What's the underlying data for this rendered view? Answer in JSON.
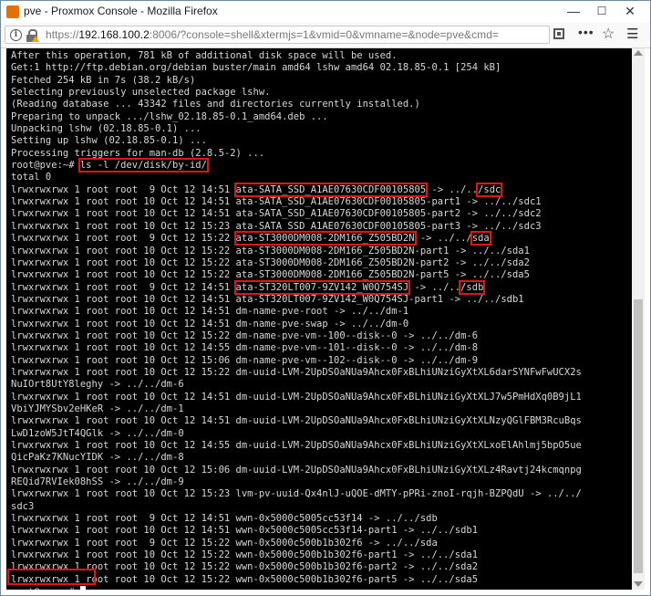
{
  "window": {
    "title": "pve - Proxmox Console - Mozilla Firefox",
    "icon": "proxmox-icon",
    "controls": [
      "—",
      "☐",
      "✕"
    ]
  },
  "address_bar": {
    "protocol": "https://",
    "host": "192.168.100.2",
    "rest": ":8006/?console=shell&xtermjs=1&vmid=0&vmname=&node=pve&cmd="
  },
  "colors": {
    "terminal_bg": "#000000",
    "terminal_fg": "#d7d7d7",
    "highlight": "#e01616"
  },
  "terminal": {
    "lines": [
      "After this operation, 781 kB of additional disk space will be used.",
      "Get:1 http://ftp.debian.org/debian buster/main amd64 lshw amd64 02.18.85-0.1 [254 kB]",
      "Fetched 254 kB in 7s (38.2 kB/s)",
      "Selecting previously unselected package lshw.",
      "(Reading database ... 43342 files and directories currently installed.)",
      "Preparing to unpack .../lshw_02.18.85-0.1_amd64.deb ...",
      "Unpacking lshw (02.18.85-0.1) ...",
      "Setting up lshw (02.18.85-0.1) ...",
      "Processing triggers for man-db (2.8.5-2) ...",
      "root@pve:~# ls -l /dev/disk/by-id/",
      "total 0",
      "lrwxrwxrwx 1 root root  9 Oct 12 14:51 ata-SATA_SSD_A1AE07630CDF00105805 -> ../../sdc",
      "lrwxrwxrwx 1 root root 10 Oct 12 14:51 ata-SATA_SSD_A1AE07630CDF00105805-part1 -> ../../sdc1",
      "lrwxrwxrwx 1 root root 10 Oct 12 14:51 ata-SATA_SSD_A1AE07630CDF00105805-part2 -> ../../sdc2",
      "lrwxrwxrwx 1 root root 10 Oct 12 15:23 ata-SATA_SSD_A1AE07630CDF00105805-part3 -> ../../sdc3",
      "lrwxrwxrwx 1 root root  9 Oct 12 15:22 ata-ST3000DM008-2DM166_Z505BD2N -> ../../sda",
      "lrwxrwxrwx 1 root root 10 Oct 12 15:22 ata-ST3000DM008-2DM166_Z505BD2N-part1 -> ../../sda1",
      "lrwxrwxrwx 1 root root 10 Oct 12 15:22 ata-ST3000DM008-2DM166_Z505BD2N-part2 -> ../../sda2",
      "lrwxrwxrwx 1 root root 10 Oct 12 15:22 ata-ST3000DM008-2DM166_Z505BD2N-part5 -> ../../sda5",
      "lrwxrwxrwx 1 root root  9 Oct 12 14:51 ata-ST320LT007-9ZV142_W0Q754SJ -> ../../sdb",
      "lrwxrwxrwx 1 root root 10 Oct 12 14:51 ata-ST320LT007-9ZV142_W0Q754SJ-part1 -> ../../sdb1",
      "lrwxrwxrwx 1 root root 10 Oct 12 14:51 dm-name-pve-root -> ../../dm-1",
      "lrwxrwxrwx 1 root root 10 Oct 12 14:51 dm-name-pve-swap -> ../../dm-0",
      "lrwxrwxrwx 1 root root 10 Oct 12 15:22 dm-name-pve-vm--100--disk--0 -> ../../dm-6",
      "lrwxrwxrwx 1 root root 10 Oct 12 14:55 dm-name-pve-vm--101--disk--0 -> ../../dm-8",
      "lrwxrwxrwx 1 root root 10 Oct 12 15:06 dm-name-pve-vm--102--disk--0 -> ../../dm-9",
      "lrwxrwxrwx 1 root root 10 Oct 12 15:22 dm-uuid-LVM-2UpDSOaNUa9Ahcx0FxBLhiUNziGyXtXL6darSYNFwFwUCX2s",
      "NuIOrt8UtY8leghy -> ../../dm-6",
      "lrwxrwxrwx 1 root root 10 Oct 12 14:51 dm-uuid-LVM-2UpDSOaNUa9Ahcx0FxBLhiUNziGyXtXLJ7w5PmHdXq0B9jL1",
      "VbiYJMYSbv2eHKeR -> ../../dm-1",
      "lrwxrwxrwx 1 root root 10 Oct 12 14:51 dm-uuid-LVM-2UpDSOaNUa9Ahcx0FxBLhiUNziGyXtXLNzyQGlFBM3RcuBqs",
      "LwD1zoW5JtT4QGlk -> ../../dm-0",
      "lrwxrwxrwx 1 root root 10 Oct 12 14:55 dm-uuid-LVM-2UpDSOaNUa9Ahcx0FxBLhiUNziGyXtXLxoElAhlmj5bpO5ue",
      "QicPaKz7KNucYIDK -> ../../dm-8",
      "lrwxrwxrwx 1 root root 10 Oct 12 15:06 dm-uuid-LVM-2UpDSOaNUa9Ahcx0FxBLhiUNziGyXtXLz4Ravtj24kcmqnpg",
      "REQid7RVIek08hSS -> ../../dm-9",
      "lrwxrwxrwx 1 root root 10 Oct 12 15:23 lvm-pv-uuid-Qx4nlJ-uQOE-dMTY-pPRi-znoI-rqjh-BZPQdU -> ../../",
      "sdc3",
      "lrwxrwxrwx 1 root root  9 Oct 12 14:51 wwn-0x5000c5005cc53f14 -> ../../sdb",
      "lrwxrwxrwx 1 root root 10 Oct 12 14:51 wwn-0x5000c5005cc53f14-part1 -> ../../sdb1",
      "lrwxrwxrwx 1 root root  9 Oct 12 15:22 wwn-0x5000c500b1b302f6 -> ../../sda",
      "lrwxrwxrwx 1 root root 10 Oct 12 15:22 wwn-0x5000c500b1b302f6-part1 -> ../../sda1",
      "lrwxrwxrwx 1 root root 10 Oct 12 15:22 wwn-0x5000c500b1b302f6-part2 -> ../../sda2",
      "lrwxrwxrwx 1 root root 10 Oct 12 15:22 wwn-0x5000c500b1b302f6-part5 -> ../../sda5",
      "root@pve:~# "
    ],
    "highlights": [
      {
        "line": 9,
        "text": "ls -l /dev/disk/by-id/"
      },
      {
        "line": 11,
        "text": "ata-SATA_SSD_A1AE07630CDF00105805"
      },
      {
        "line": 11,
        "text": "/sdc"
      },
      {
        "line": 15,
        "text": "ata-ST3000DM008-2DM166_Z505BD2N"
      },
      {
        "line": 15,
        "text": "sda"
      },
      {
        "line": 19,
        "text": "ata-ST320LT007-9ZV142_W0Q754SJ"
      },
      {
        "line": 19,
        "text": "/sdb"
      }
    ]
  }
}
